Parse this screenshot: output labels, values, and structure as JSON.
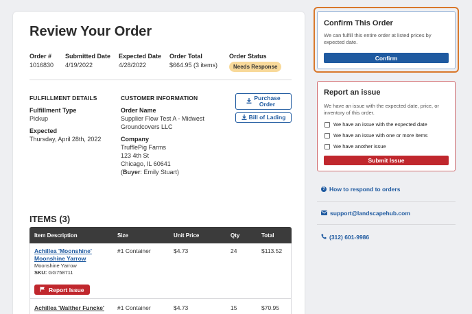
{
  "page": {
    "title": "Review Your Order"
  },
  "order": {
    "number_label": "Order #",
    "number": "1016830",
    "submitted_label": "Submitted Date",
    "submitted": "4/19/2022",
    "expected_label": "Expected Date",
    "expected": "4/28/2022",
    "total_label": "Order Total",
    "total": "$664.95 (3 items)",
    "status_label": "Order Status",
    "status": "Needs Response"
  },
  "fulfillment": {
    "heading": "FULFILLMENT DETAILS",
    "type_label": "Fulfillment Type",
    "type": "Pickup",
    "expected_label": "Expected",
    "expected": "Thursday, April 28th, 2022"
  },
  "customer": {
    "heading": "CUSTOMER INFORMATION",
    "order_name_label": "Order Name",
    "order_name_line1": "Supplier Flow Test A - Midwest",
    "order_name_line2": "Groundcovers LLC",
    "company_label": "Company",
    "company_name": "TrufflePig Farms",
    "address_line1": "123 4th St",
    "address_line2": "Chicago, IL 60641",
    "buyer_prefix": "(",
    "buyer_label": "Buyer",
    "buyer_name": ": Emily Stuart)"
  },
  "buttons": {
    "purchase_order_line1": "Purchase",
    "purchase_order_line2": "Order",
    "bill_of_lading": "Bill of Lading",
    "download_icon": "download-icon"
  },
  "items": {
    "heading": "ITEMS (3)",
    "columns": [
      "Item Description",
      "Size",
      "Unit Price",
      "Qty",
      "Total"
    ],
    "rows": [
      {
        "name_line1": "Achillea 'Moonshine'",
        "name_line2": "Moonshine Yarrow",
        "common": "Moonshine Yarrow",
        "sku_label": "SKU:",
        "sku": " GG758711",
        "size": "#1 Container",
        "unit_price": "$4.73",
        "qty": "24",
        "total": "$113.52",
        "report_label": "Report Issue"
      },
      {
        "name_line1": "Achillea 'Walther Funcke'",
        "size": "#1 Container",
        "unit_price": "$4.73",
        "qty": "15",
        "total": "$70.95"
      }
    ]
  },
  "confirm": {
    "heading": "Confirm This Order",
    "text": "We can fulfill this entire order at listed prices by expected date.",
    "button": "Confirm"
  },
  "report": {
    "heading": "Report an issue",
    "text": "We have an issue with the expected date, price, or inventory of this order.",
    "options": [
      "We have an issue with the expected date",
      "We have an issue with one or more items",
      "We have another issue"
    ],
    "button": "Submit Issue"
  },
  "help": {
    "respond_link": "How to respond to orders",
    "email": "support@landscapehub.com",
    "phone": "(312) 601-9986"
  },
  "colors": {
    "primary": "#1f5aa0",
    "danger": "#c0272d",
    "highlight": "#d9782b",
    "badge": "#f8d99a"
  }
}
